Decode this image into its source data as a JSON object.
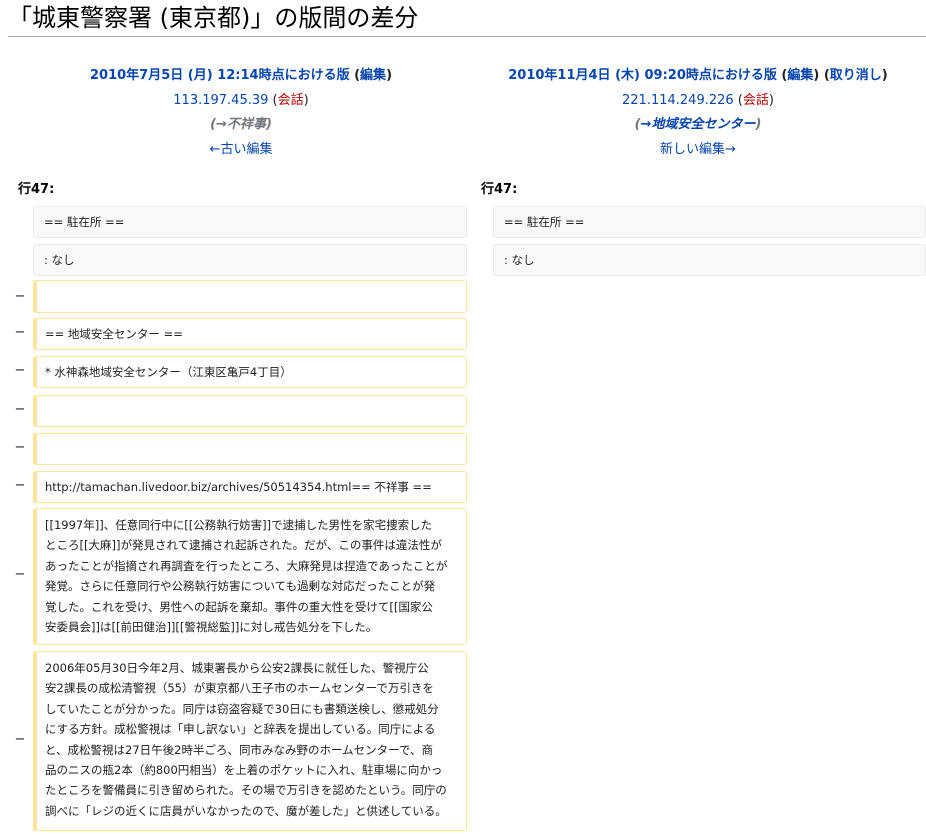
{
  "page": {
    "title": "「城東警察署 (東京都)」の版間の差分"
  },
  "left_header": {
    "revision": "2010年7月5日 (月) 12:14時点における版",
    "paren_open": " (",
    "edit_link": "編集",
    "paren_close": ")",
    "user": "113.197.45.39",
    "talk_open": " (",
    "talk_link": "会話",
    "talk_close": ")",
    "summary": "(→不祥事)",
    "nav": "←古い編集"
  },
  "right_header": {
    "revision": "2010年11月4日 (木) 09:20時点における版",
    "paren_open": " (",
    "edit_link": "編集",
    "paren_mid": ") (",
    "undo_link": "取り消し",
    "paren_close": ")",
    "user": "221.114.249.226",
    "talk_open": " (",
    "talk_link": "会話",
    "talk_close": ")",
    "summary_open": "(",
    "summary_link": "→地域安全センター",
    "summary_close": ")",
    "nav": "新しい編集→"
  },
  "line_label_left": "行47:",
  "line_label_right": "行47:",
  "context_lines": [
    "== 駐在所 ==",
    ": なし"
  ],
  "removed_marker": "−",
  "removed_lines": [
    "",
    "== 地域安全センター ==",
    "* 水神森地域安全センター（江東区亀戸4丁目）",
    "",
    "",
    "http://tamachan.livedoor.biz/archives/50514354.html== 不祥事 =="
  ],
  "removed_paragraphs": [
    {
      "lines": [
        "[[1997年]]、任意同行中に[[公務執行妨害]]で逮捕した男性を家宅捜索した",
        "ところ[[大麻]]が発見されて逮捕され起訴された。だが、この事件は違法性が",
        "あったことが指摘され再調査を行ったところ、大麻発見は捏造であったことが",
        "発覚。さらに任意同行や公務執行妨害についても過剰な対応だったことが発",
        "覚した。これを受け、男性への起訴を棄却。事件の重大性を受けて[[国家公",
        "安委員会]]は[[前田健治]][[警視総監]]に対し戒告処分を下した。"
      ]
    },
    {
      "lines": [
        "2006年05月30日今年2月、城東署長から公安2課長に就任した、警視庁公",
        "安2課長の成松清警視（55）が東京都八王子市のホームセンターで万引きを",
        "していたことが分かった。同庁は窃盗容疑で30日にも書類送検し、懲戒処分",
        "にする方針。成松警視は「申し訳ない」と辞表を提出している。同庁による",
        "と、成松警視は27日午後2時半ごろ、同市みなみ野のホームセンターで、商",
        "品のニスの瓶2本（約800円相当）を上着のポケットに入れ、駐車場に向かっ",
        "たところを警備員に引き留められた。その場で万引きを認めたという。同庁の",
        "調べに「レジの近くに店員がいなかったので、魔が差した」と供述している。"
      ]
    }
  ],
  "colors": {
    "link": "#0645ad",
    "talk_link": "#ba0000",
    "removed_border": "#ffe49c",
    "context_bg": "#f8f9fa"
  }
}
